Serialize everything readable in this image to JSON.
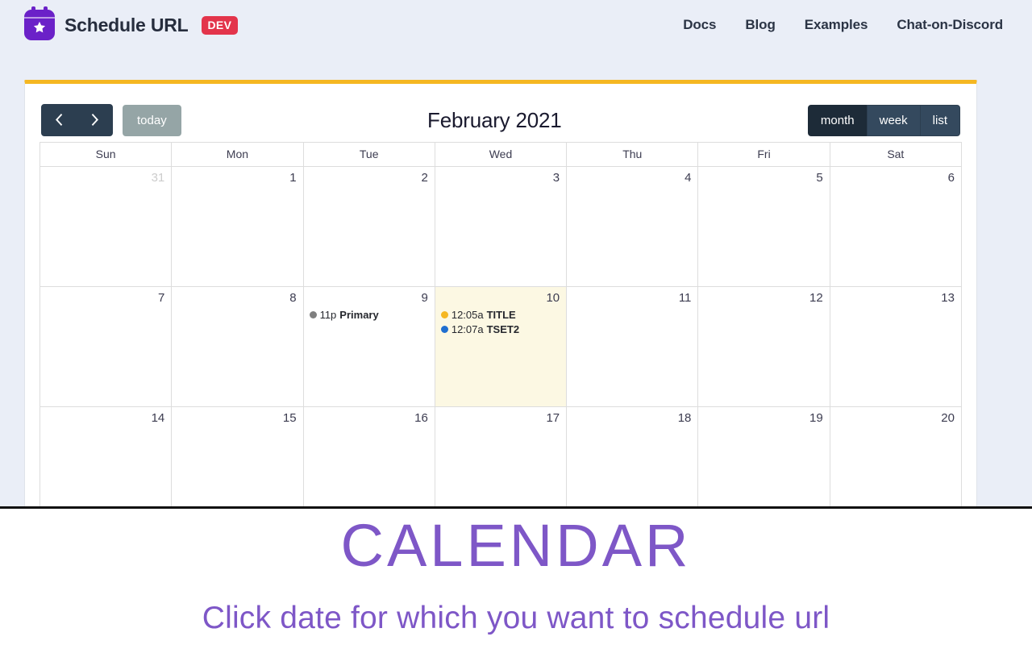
{
  "header": {
    "brand_title": "Schedule URL",
    "badge": "DEV",
    "logo_icon": "calendar-star-icon",
    "nav": [
      {
        "label": "Docs"
      },
      {
        "label": "Blog"
      },
      {
        "label": "Examples"
      },
      {
        "label": "Chat-on-Discord"
      }
    ]
  },
  "calendar": {
    "accent_top_color": "#f5b722",
    "toolbar": {
      "prev_icon": "chevron-left-icon",
      "next_icon": "chevron-right-icon",
      "today_label": "today",
      "title": "February 2021",
      "views": [
        {
          "label": "month",
          "active": true
        },
        {
          "label": "week",
          "active": false
        },
        {
          "label": "list",
          "active": false
        }
      ]
    },
    "day_headers": [
      "Sun",
      "Mon",
      "Tue",
      "Wed",
      "Thu",
      "Fri",
      "Sat"
    ],
    "weeks": [
      {
        "days": [
          {
            "num": "31",
            "other_month": true,
            "today": false,
            "events": []
          },
          {
            "num": "1",
            "other_month": false,
            "today": false,
            "events": []
          },
          {
            "num": "2",
            "other_month": false,
            "today": false,
            "events": []
          },
          {
            "num": "3",
            "other_month": false,
            "today": false,
            "events": []
          },
          {
            "num": "4",
            "other_month": false,
            "today": false,
            "events": []
          },
          {
            "num": "5",
            "other_month": false,
            "today": false,
            "events": []
          },
          {
            "num": "6",
            "other_month": false,
            "today": false,
            "events": []
          }
        ]
      },
      {
        "days": [
          {
            "num": "7",
            "other_month": false,
            "today": false,
            "events": []
          },
          {
            "num": "8",
            "other_month": false,
            "today": false,
            "events": []
          },
          {
            "num": "9",
            "other_month": false,
            "today": false,
            "events": [
              {
                "time": "11p",
                "title": "Primary",
                "dot_color": "#808080"
              }
            ]
          },
          {
            "num": "10",
            "other_month": false,
            "today": true,
            "events": [
              {
                "time": "12:05a",
                "title": "TITLE",
                "dot_color": "#f5b722"
              },
              {
                "time": "12:07a",
                "title": "TSET2",
                "dot_color": "#1f6fd0"
              }
            ]
          },
          {
            "num": "11",
            "other_month": false,
            "today": false,
            "events": []
          },
          {
            "num": "12",
            "other_month": false,
            "today": false,
            "events": []
          },
          {
            "num": "13",
            "other_month": false,
            "today": false,
            "events": []
          }
        ]
      },
      {
        "days": [
          {
            "num": "14",
            "other_month": false,
            "today": false,
            "events": []
          },
          {
            "num": "15",
            "other_month": false,
            "today": false,
            "events": []
          },
          {
            "num": "16",
            "other_month": false,
            "today": false,
            "events": []
          },
          {
            "num": "17",
            "other_month": false,
            "today": false,
            "events": []
          },
          {
            "num": "18",
            "other_month": false,
            "today": false,
            "events": []
          },
          {
            "num": "19",
            "other_month": false,
            "today": false,
            "events": []
          },
          {
            "num": "20",
            "other_month": false,
            "today": false,
            "events": []
          }
        ]
      }
    ]
  },
  "bottom": {
    "heading": "CALENDAR",
    "subheading": "Click date for which you want to schedule url",
    "text_color": "#7e57c7"
  }
}
